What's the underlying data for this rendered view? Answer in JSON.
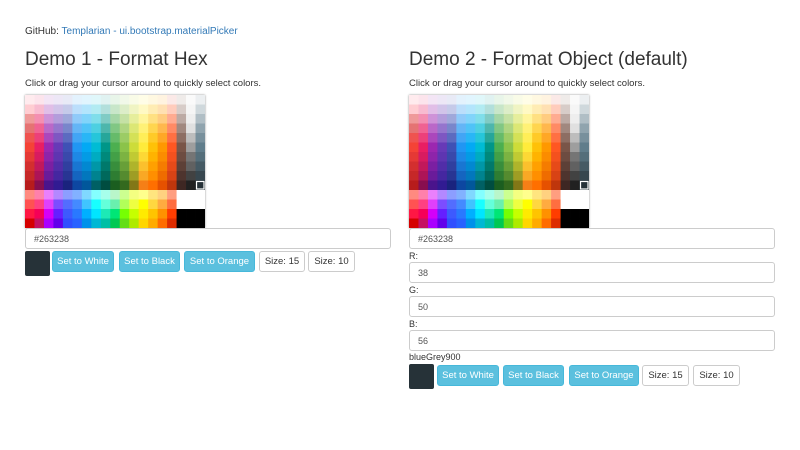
{
  "github": {
    "prefix": "GitHub:",
    "link_text": "Templarian - ui.bootstrap.materialPicker"
  },
  "palette_colors": [
    [
      "#FFEBEE",
      "#FCE4EC",
      "#F3E5F5",
      "#EDE7F6",
      "#E8EAF6",
      "#E3F2FD",
      "#E1F5FE",
      "#E0F7FA",
      "#E0F2F1",
      "#E8F5E9",
      "#F1F8E9",
      "#F9FBE7",
      "#FFFDE7",
      "#FFF8E1",
      "#FFF3E0",
      "#FBE9E7",
      "#EFEBE9",
      "#FAFAFA",
      "#ECEFF1"
    ],
    [
      "#FFCDD2",
      "#F8BBD0",
      "#E1BEE7",
      "#D1C4E9",
      "#C5CAE9",
      "#BBDEFB",
      "#B3E5FC",
      "#B2EBF2",
      "#B2DFDB",
      "#C8E6C9",
      "#DCEDC8",
      "#F0F4C3",
      "#FFF9C4",
      "#FFECB3",
      "#FFE0B2",
      "#FFCCBC",
      "#D7CCC8",
      "#F5F5F5",
      "#CFD8DC"
    ],
    [
      "#EF9A9A",
      "#F48FB1",
      "#CE93D8",
      "#B39DDB",
      "#9FA8DA",
      "#90CAF9",
      "#81D4FA",
      "#80DEEA",
      "#80CBC4",
      "#A5D6A7",
      "#C5E1A5",
      "#E6EE9C",
      "#FFF59D",
      "#FFE082",
      "#FFCC80",
      "#FFAB91",
      "#BCAAA4",
      "#EEEEEE",
      "#B0BEC5"
    ],
    [
      "#E57373",
      "#F06292",
      "#BA68C8",
      "#9575CD",
      "#7986CB",
      "#64B5F6",
      "#4FC3F7",
      "#4DD0E1",
      "#4DB6AC",
      "#81C784",
      "#AED581",
      "#DCE775",
      "#FFF176",
      "#FFD54F",
      "#FFB74D",
      "#FF8A65",
      "#A1887F",
      "#E0E0E0",
      "#90A4AE"
    ],
    [
      "#EF5350",
      "#EC407A",
      "#AB47BC",
      "#7E57C2",
      "#5C6BC0",
      "#42A5F5",
      "#29B6F6",
      "#26C6DA",
      "#26A69A",
      "#66BB6A",
      "#9CCC65",
      "#D4E157",
      "#FFEE58",
      "#FFCA28",
      "#FFA726",
      "#FF7043",
      "#8D6E63",
      "#BDBDBD",
      "#78909C"
    ],
    [
      "#F44336",
      "#E91E63",
      "#9C27B0",
      "#673AB7",
      "#3F51B5",
      "#2196F3",
      "#03A9F4",
      "#00BCD4",
      "#009688",
      "#4CAF50",
      "#8BC34A",
      "#CDDC39",
      "#FFEB3B",
      "#FFC107",
      "#FF9800",
      "#FF5722",
      "#795548",
      "#9E9E9E",
      "#607D8B"
    ],
    [
      "#E53935",
      "#D81B60",
      "#8E24AA",
      "#5E35B1",
      "#3949AB",
      "#1E88E5",
      "#039BE5",
      "#00ACC1",
      "#00897B",
      "#43A047",
      "#7CB342",
      "#C0CA33",
      "#FDD835",
      "#FFB300",
      "#FB8C00",
      "#F4511E",
      "#6D4C41",
      "#757575",
      "#546E7A"
    ],
    [
      "#D32F2F",
      "#C2185B",
      "#7B1FA2",
      "#512DA8",
      "#303F9F",
      "#1976D2",
      "#0288D1",
      "#0097A7",
      "#00796B",
      "#388E3C",
      "#689F38",
      "#AFB42B",
      "#FBC02D",
      "#FFA000",
      "#F57C00",
      "#E64A19",
      "#5D4037",
      "#616161",
      "#455A64"
    ],
    [
      "#C62828",
      "#AD1457",
      "#6A1B9A",
      "#4527A0",
      "#283593",
      "#1565C0",
      "#0277BD",
      "#00838F",
      "#00695C",
      "#2E7D32",
      "#558B2F",
      "#9E9D24",
      "#F9A825",
      "#FF8F00",
      "#EF6C00",
      "#D84315",
      "#4E342E",
      "#424242",
      "#37474F"
    ],
    [
      "#B71C1C",
      "#880E4F",
      "#4A148C",
      "#311B92",
      "#1A237E",
      "#0D47A1",
      "#01579B",
      "#006064",
      "#004D40",
      "#1B5E20",
      "#33691E",
      "#827717",
      "#F57F17",
      "#FF6F00",
      "#E65100",
      "#BF360C",
      "#3E2723",
      "#212121",
      "#263238"
    ],
    [
      "#FF8A80",
      "#FF80AB",
      "#EA80FC",
      "#B388FF",
      "#8C9EFF",
      "#82B1FF",
      "#80D8FF",
      "#84FFFF",
      "#A7FFEB",
      "#B9F6CA",
      "#CCFF90",
      "#F4FF81",
      "#FFFF8D",
      "#FFE57F",
      "#FFD180",
      "#FF9E80",
      "#FFFFFF",
      "#FFFFFF",
      "#FFFFFF"
    ],
    [
      "#FF5252",
      "#FF4081",
      "#E040FB",
      "#7C4DFF",
      "#536DFE",
      "#448AFF",
      "#40C4FF",
      "#18FFFF",
      "#64FFDA",
      "#69F0AE",
      "#B2FF59",
      "#EEFF41",
      "#FFFF00",
      "#FFD740",
      "#FFAB40",
      "#FF6E40",
      "#FFFFFF",
      "#FFFFFF",
      "#FFFFFF"
    ],
    [
      "#FF1744",
      "#F50057",
      "#D500F9",
      "#651FFF",
      "#3D5AFE",
      "#2979FF",
      "#00B0FF",
      "#00E5FF",
      "#1DE9B6",
      "#00E676",
      "#76FF03",
      "#C6FF00",
      "#FFEA00",
      "#FFC400",
      "#FF9100",
      "#FF3D00",
      "#000000",
      "#000000",
      "#000000"
    ],
    [
      "#D50000",
      "#C51162",
      "#AA00FF",
      "#6200EA",
      "#304FFE",
      "#2962FF",
      "#0091EA",
      "#00B8D4",
      "#00BFA5",
      "#00C853",
      "#64DD17",
      "#AEEA00",
      "#FFD600",
      "#FFAB00",
      "#FF6D00",
      "#DD2C00",
      "#000000",
      "#000000",
      "#000000"
    ]
  ],
  "demo1": {
    "title": "Demo 1 - Format Hex",
    "hint": "Click or drag your cursor around to quickly select colors.",
    "hex_value": "#263238",
    "selected_color": "#263238",
    "buttons": {
      "white": "Set to White",
      "black": "Set to Black",
      "orange": "Set to Orange",
      "size15": "Size: 15",
      "size10": "Size: 10"
    }
  },
  "demo2": {
    "title": "Demo 2 - Format Object (default)",
    "hint": "Click or drag your cursor around to quickly select colors.",
    "hex_value": "#263238",
    "r_label": "R:",
    "r_value": "38",
    "g_label": "G:",
    "g_value": "50",
    "b_label": "B:",
    "b_value": "56",
    "color_name": "blueGrey900",
    "selected_color": "#263238",
    "buttons": {
      "white": "Set to White",
      "black": "Set to Black",
      "orange": "Set to Orange",
      "size15": "Size: 15",
      "size10": "Size: 10"
    }
  }
}
